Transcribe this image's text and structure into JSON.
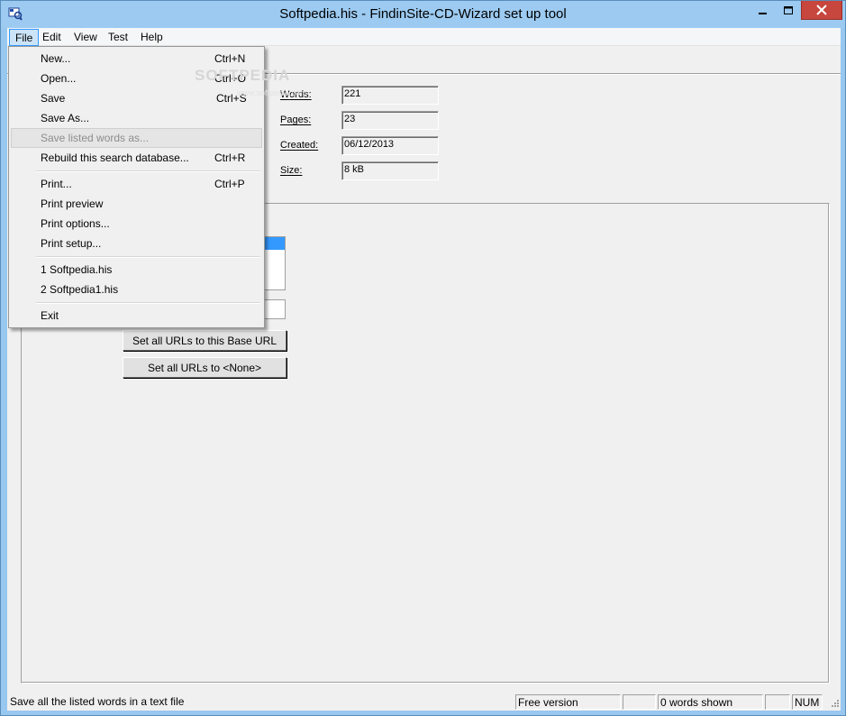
{
  "window": {
    "title": "Softpedia.his - FindinSite-CD-Wizard set up tool"
  },
  "menubar": [
    {
      "label": "File"
    },
    {
      "label": "Edit"
    },
    {
      "label": "View"
    },
    {
      "label": "Test"
    },
    {
      "label": "Help"
    }
  ],
  "file_menu": {
    "items": [
      {
        "label": "New...",
        "shortcut": "Ctrl+N"
      },
      {
        "label": "Open...",
        "shortcut": "Ctrl+O"
      },
      {
        "label": "Save",
        "shortcut": "Ctrl+S"
      },
      {
        "label": "Save As...",
        "shortcut": ""
      },
      {
        "label": "Save listed words as...",
        "shortcut": ""
      },
      {
        "label": "Rebuild this search database...",
        "shortcut": "Ctrl+R"
      },
      {
        "label": "Print...",
        "shortcut": "Ctrl+P"
      },
      {
        "label": "Print preview",
        "shortcut": ""
      },
      {
        "label": "Print options...",
        "shortcut": ""
      },
      {
        "label": "Print setup...",
        "shortcut": ""
      },
      {
        "label": "1 Softpedia.his",
        "shortcut": ""
      },
      {
        "label": "2 Softpedia1.his",
        "shortcut": ""
      },
      {
        "label": "Exit",
        "shortcut": ""
      }
    ]
  },
  "stats": {
    "words_label_u": "W",
    "words_label_rest": "ords:",
    "words_value": "221",
    "pages_label_u": "P",
    "pages_label_rest": "ages:",
    "pages_value": "23",
    "created_label_u": "C",
    "created_label_rest": "reated:",
    "created_value": "06/12/2013",
    "size_label_u": "S",
    "size_label_rest": "ize:",
    "size_value": "8 kB"
  },
  "buttons": {
    "set_base_url": "Set all URLs to this Base URL",
    "set_none": "Set all URLs to <None>"
  },
  "statusbar": {
    "message": "Save all the listed words in a text file",
    "version": "Free version",
    "words_shown": "0 words shown",
    "num": "NUM"
  },
  "watermark": {
    "text": "SOFTPEDIA",
    "sub": "www.softpedia.com"
  },
  "colors": {
    "title_bar": "#9ccaf1",
    "close_button": "#c7463e",
    "selection": "#3399ff"
  }
}
